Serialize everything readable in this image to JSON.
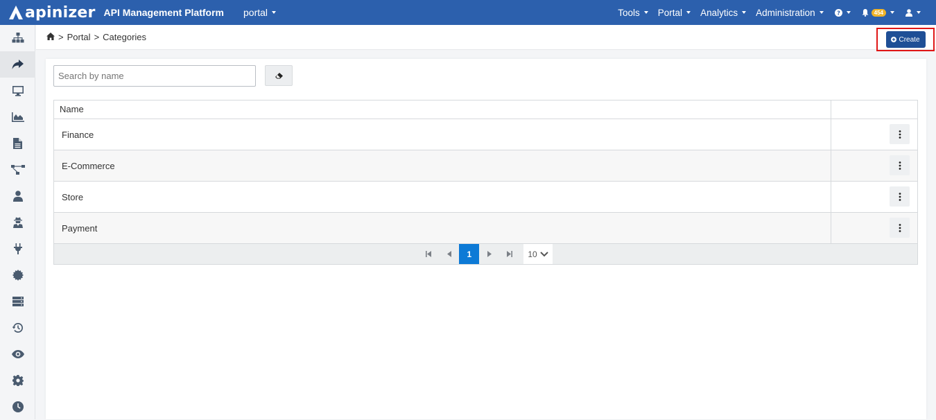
{
  "navbar": {
    "logo_text": "apinizer",
    "product": "API Management Platform",
    "project": "portal",
    "menus": [
      "Tools",
      "Portal",
      "Analytics",
      "Administration"
    ],
    "notification_count": "454"
  },
  "breadcrumb": {
    "items": [
      "Portal",
      "Categories"
    ],
    "separator": ">"
  },
  "actions": {
    "create_label": "Create"
  },
  "search": {
    "placeholder": "Search by name",
    "value": ""
  },
  "table": {
    "header_name": "Name",
    "rows": [
      "Finance",
      "E-Commerce",
      "Store",
      "Payment"
    ]
  },
  "pagination": {
    "current_page": "1",
    "page_size": "10"
  },
  "colors": {
    "navbar": "#2c60ad",
    "primary_button": "#1f4f96",
    "highlight_box": "#e01616",
    "current_page": "#0d7ad6"
  }
}
